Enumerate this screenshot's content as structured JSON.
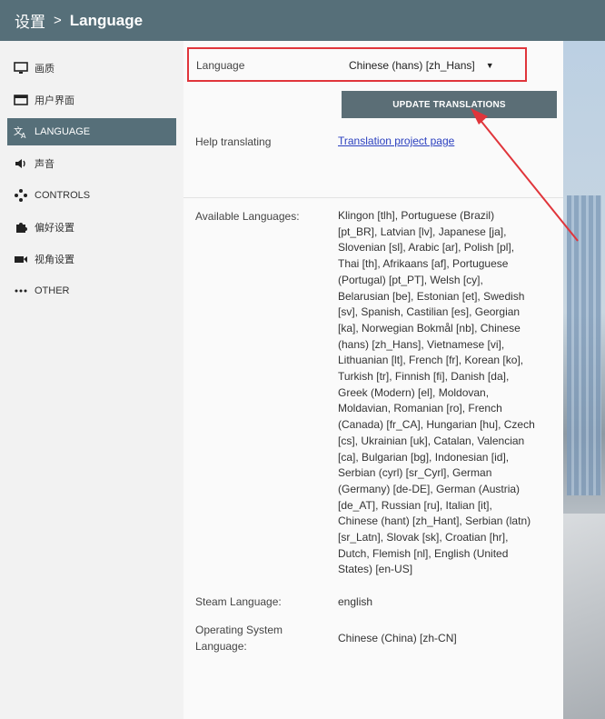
{
  "header": {
    "parent": "设置",
    "separator": ">",
    "current": "Language"
  },
  "sidebar": {
    "items": [
      {
        "label": "画质",
        "icon": "monitor-icon"
      },
      {
        "label": "用户界面",
        "icon": "window-icon"
      },
      {
        "label": "LANGUAGE",
        "icon": "translate-icon",
        "active": true
      },
      {
        "label": "声音",
        "icon": "speaker-icon"
      },
      {
        "label": "CONTROLS",
        "icon": "gamepad-icon"
      },
      {
        "label": "偏好设置",
        "icon": "puzzle-icon"
      },
      {
        "label": "视角设置",
        "icon": "camera-icon"
      },
      {
        "label": "OTHER",
        "icon": "ellipsis-icon"
      }
    ]
  },
  "settings": {
    "language_label": "Language",
    "language_value": "Chinese (hans) [zh_Hans]",
    "update_button": "UPDATE TRANSLATIONS",
    "help_label": "Help translating",
    "help_link": "Translation project page",
    "available_label": "Available Languages:",
    "available_lines": [
      "Klingon [tlh], Portuguese (Brazil)",
      "[pt_BR], Latvian [lv], Japanese [ja],",
      "Slovenian [sl], Arabic [ar], Polish [pl],",
      "Thai [th], Afrikaans [af], Portuguese",
      "(Portugal) [pt_PT], Welsh [cy],",
      "Belarusian [be], Estonian [et], Swedish",
      "[sv], Spanish, Castilian [es], Georgian",
      "[ka], Norwegian Bokmål [nb], Chinese",
      "(hans) [zh_Hans], Vietnamese [vi],",
      "Lithuanian [lt], French [fr], Korean [ko],",
      "Turkish [tr], Finnish [fi], Danish [da],",
      "Greek (Modern) [el], Moldovan,",
      "Moldavian, Romanian [ro], French",
      "(Canada) [fr_CA], Hungarian [hu], Czech",
      "[cs], Ukrainian [uk], Catalan, Valencian",
      "[ca], Bulgarian [bg], Indonesian [id],",
      "Serbian (cyrl) [sr_Cyrl], German",
      "(Germany) [de-DE], German (Austria)",
      "[de_AT], Russian [ru], Italian [it],",
      "Chinese (hant) [zh_Hant], Serbian (latn)",
      "[sr_Latn], Slovak [sk], Croatian [hr],",
      "Dutch, Flemish [nl], English (United",
      "States) [en-US]"
    ],
    "steam_label": "Steam Language:",
    "steam_value": "english",
    "os_label_1": "Operating System",
    "os_label_2": "Language:",
    "os_value": "Chinese (China) [zh-CN]"
  },
  "colors": {
    "header": "#566f79",
    "highlight_box": "#e0353b",
    "button": "#5b6e76",
    "link": "#2a3fbf"
  }
}
